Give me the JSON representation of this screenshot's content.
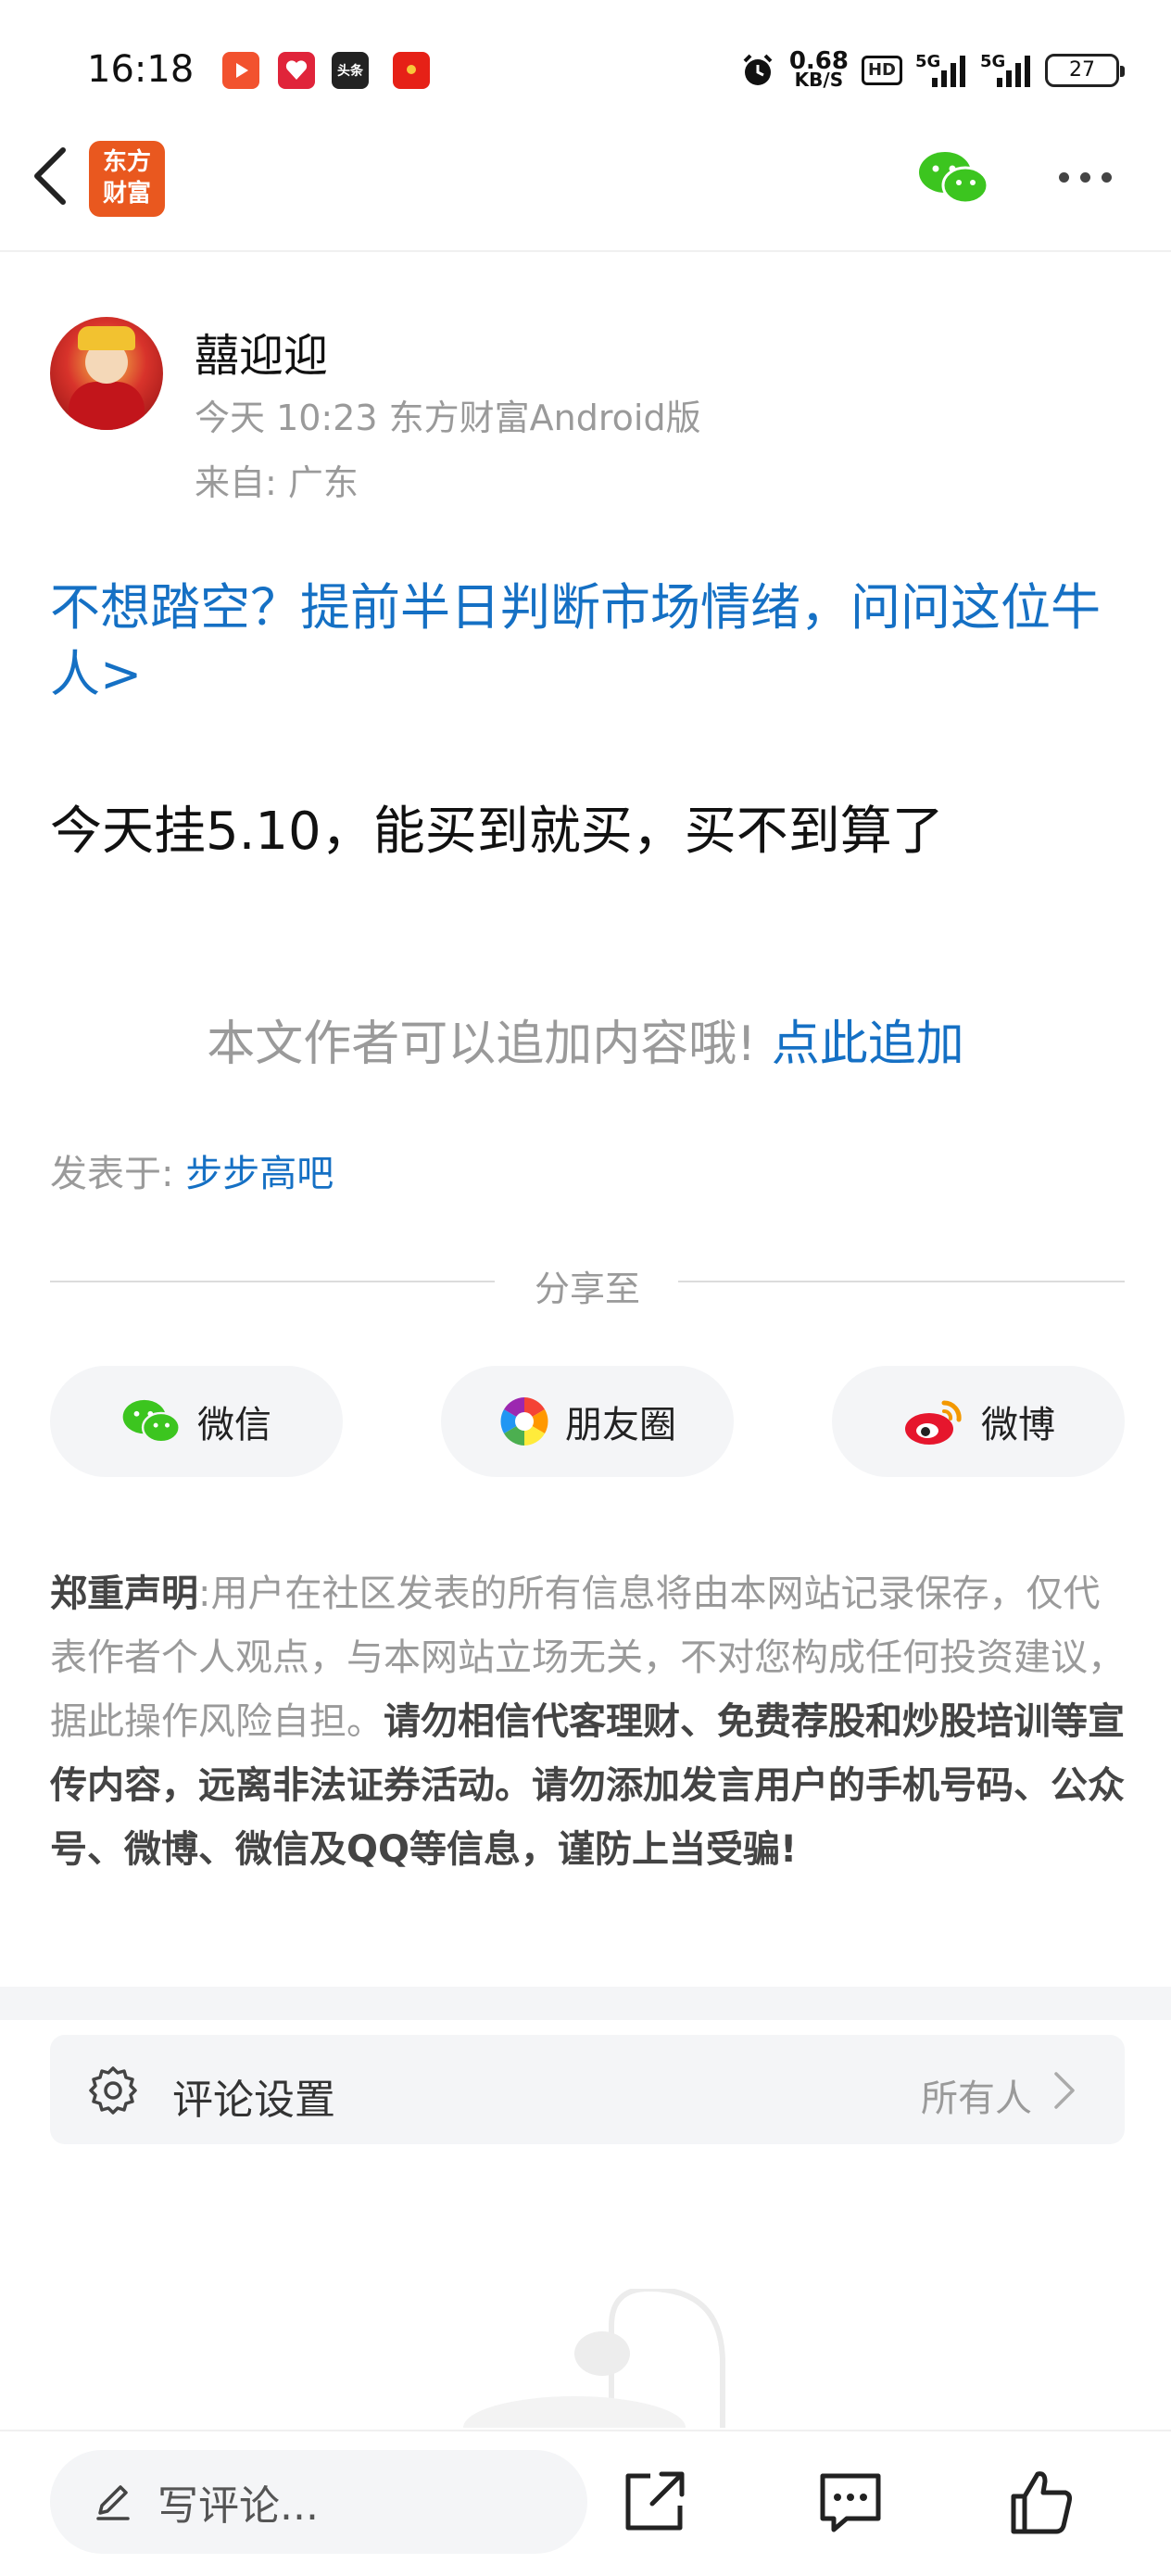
{
  "status_bar": {
    "time": "16:18",
    "net_speed_value": "0.68",
    "net_speed_unit": "KB/S",
    "hd_label": "HD",
    "signal1_label": "5G",
    "signal2_label": "5G",
    "battery": "27",
    "app_icons": [
      "video-app-icon",
      "shopping-app-icon",
      "toutiao-app-icon",
      "redpacket-app-icon"
    ],
    "toutiao_label": "头条"
  },
  "header": {
    "logo_line1": "东方",
    "logo_line2": "财富",
    "icons": [
      "back-arrow-icon",
      "wechat-icon",
      "more-icon"
    ]
  },
  "author": {
    "name": "囍迎迎",
    "meta": "今天 10:23 东方财富Android版",
    "location": "来自: 广东"
  },
  "promo_link": "不想踏空？提前半日判断市场情绪，问问这位牛人>",
  "post_body": "今天挂5.10，能买到就买，买不到算了",
  "append": {
    "text": "本文作者可以追加内容哦!",
    "link": "点此追加"
  },
  "forum": {
    "label": "发表于:",
    "name": "步步高吧"
  },
  "share": {
    "title": "分享至",
    "buttons": [
      {
        "label": "微信",
        "icon": "wechat-icon"
      },
      {
        "label": "朋友圈",
        "icon": "moments-icon"
      },
      {
        "label": "微博",
        "icon": "weibo-icon"
      }
    ]
  },
  "disclaimer": {
    "title": "郑重声明",
    "colon": ":",
    "normal": "用户在社区发表的所有信息将由本网站记录保存，仅代表作者个人观点，与本网站立场无关，不对您构成任何投资建议，据此操作风险自担。",
    "bold": "请勿相信代客理财、免费荐股和炒股培训等宣传内容，远离非法证券活动。请勿添加发言用户的手机号码、公众号、微博、微信及QQ等信息，谨防上当受骗!"
  },
  "comment_settings": {
    "label": "评论设置",
    "value": "所有人",
    "icons": [
      "gear-icon",
      "chevron-right-icon"
    ]
  },
  "bottom_bar": {
    "placeholder": "写评论...",
    "icons": [
      "pencil-icon",
      "share-icon",
      "comment-icon",
      "like-icon"
    ]
  },
  "colors": {
    "link_blue": "#1570c4",
    "brand_orange": "#e9581f",
    "muted_gray": "#9a9a9a",
    "panel_gray": "#f4f5f7"
  }
}
